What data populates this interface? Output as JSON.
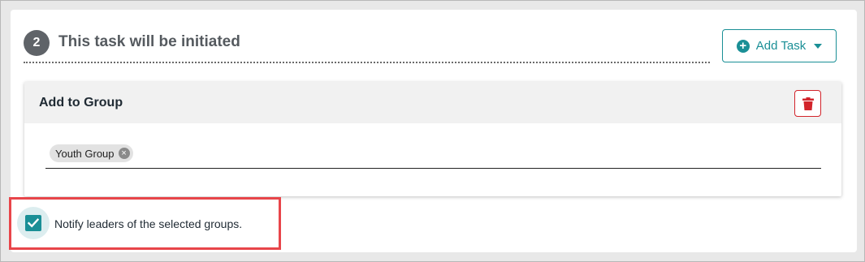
{
  "step": {
    "number": "2",
    "title": "This task will be initiated"
  },
  "toolbar": {
    "add_task_label": "Add Task",
    "add_task_icon": "plus-circle-icon",
    "dropdown_icon": "caret-down-icon"
  },
  "task_card": {
    "title": "Add to Group",
    "delete_icon": "trash-icon",
    "selected_groups": [
      {
        "label": "Youth Group",
        "remove_icon": "close-circle-icon"
      }
    ]
  },
  "notify": {
    "checked": true,
    "label": "Notify leaders of the selected groups."
  },
  "colors": {
    "accent": "#1a8f96",
    "danger": "#d2242b",
    "highlight": "#e8454a",
    "step_badge": "#5f6368"
  }
}
